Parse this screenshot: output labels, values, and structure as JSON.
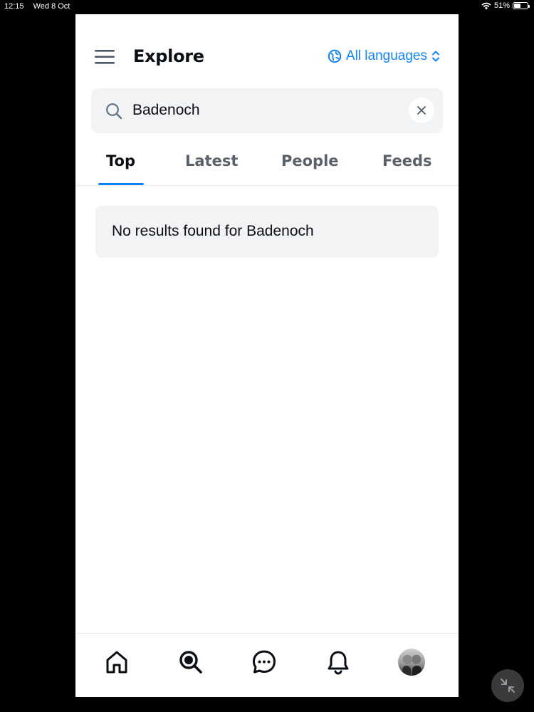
{
  "status_bar": {
    "time": "12:15",
    "date": "Wed 8 Oct",
    "battery": "51%",
    "battery_level": 0.51
  },
  "header": {
    "title": "Explore",
    "menu_icon": "hamburger-menu-icon",
    "language_label": "All languages",
    "language_icon": "globe-icon",
    "language_chevron": "chevron-up-down-icon"
  },
  "search": {
    "value": "Badenoch",
    "icon": "search-icon",
    "clear_icon": "close-icon"
  },
  "tabs": [
    {
      "label": "Top",
      "active": true
    },
    {
      "label": "Latest",
      "active": false
    },
    {
      "label": "People",
      "active": false
    },
    {
      "label": "Feeds",
      "active": false
    }
  ],
  "results": {
    "empty_message": "No results found for Badenoch"
  },
  "bottom_nav": [
    {
      "icon": "home-icon"
    },
    {
      "icon": "search-icon",
      "active": true
    },
    {
      "icon": "chat-icon"
    },
    {
      "icon": "bell-icon"
    },
    {
      "icon": "avatar"
    }
  ],
  "colors": {
    "accent": "#1083fe",
    "text": "#0b0f14",
    "muted": "#5a6068",
    "surface": "#f1f3f5"
  }
}
